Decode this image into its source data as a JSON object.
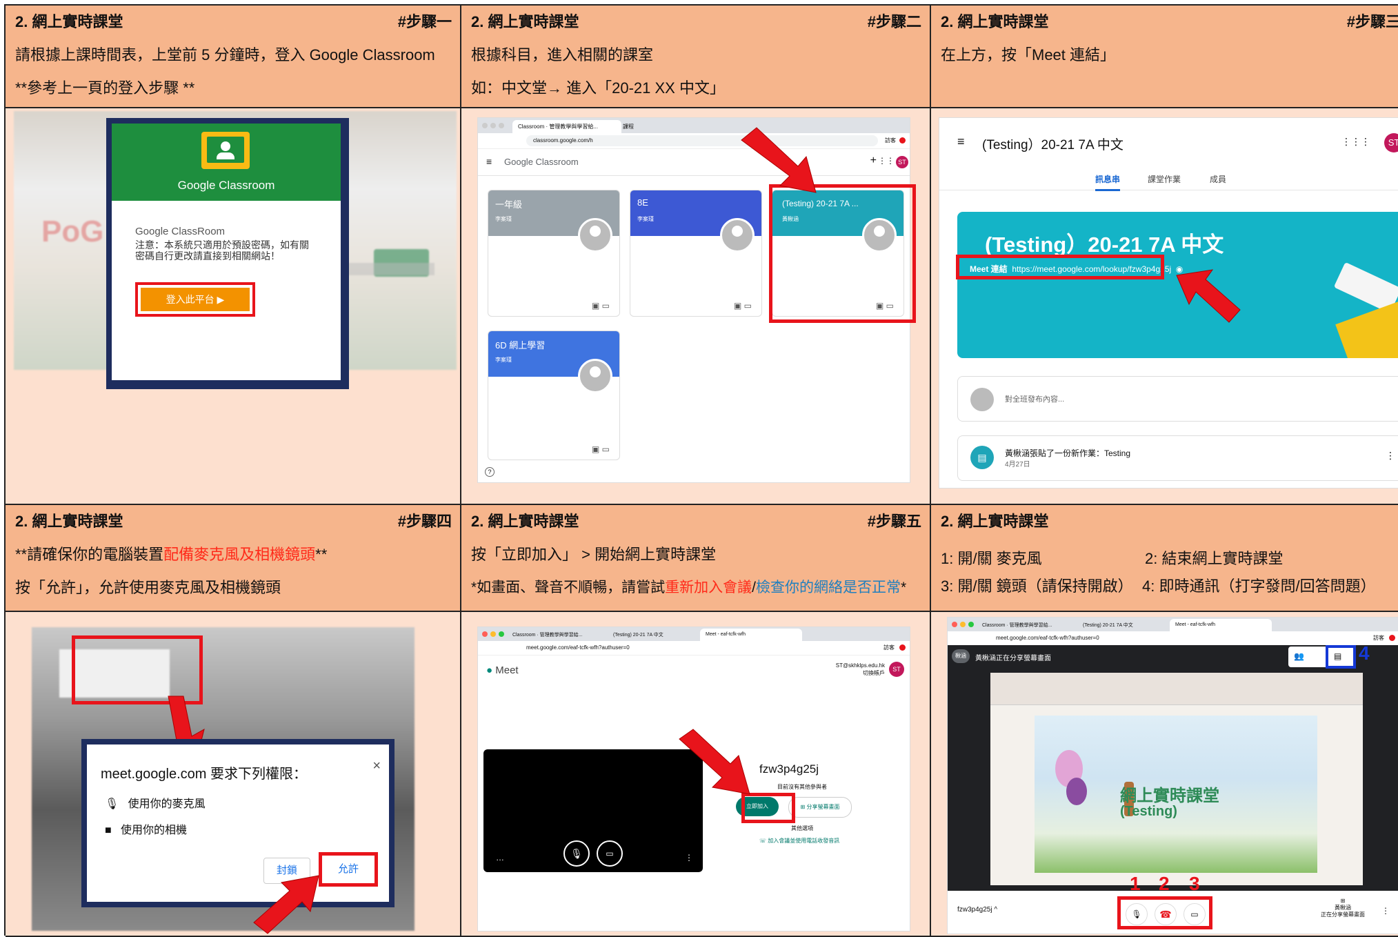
{
  "panels": [
    {
      "title": "2. 網上實時課堂",
      "step": "#步驟一",
      "line1": "請根據上課時間表，上堂前 5 分鐘時，登入 Google Classroom",
      "line2": "**參考上一頁的登入步驟 **",
      "shot": {
        "brand": "Google Classroom",
        "app_name": "Google ClassRoom",
        "notice": "注意：本系統只適用於預設密碼，如有關密碼自行更改請直接到相關網站！",
        "login_button": "登入此平台"
      }
    },
    {
      "title": "2. 網上實時課堂",
      "step": "#步驟二",
      "line1": "根據科目，進入相關的課室",
      "line2": "如：中文堂→ 進入「20-21 XX 中文」",
      "shot": {
        "tab1": "Classroom · 管理教學與學習給...",
        "tab2": "課程",
        "url": "classroom.google.com/h",
        "guest": "訪客",
        "header_brand": "Google Classroom",
        "avatar": "ST",
        "cards": [
          {
            "name": "一年級",
            "teacher": "李案瑾",
            "color": "#9aa4ab"
          },
          {
            "name": "8E",
            "teacher": "李案瑾",
            "color": "#3d59d4"
          },
          {
            "name": "(Testing) 20-21 7A ...",
            "teacher": "黃楸涵",
            "color": "#1fa5b8"
          },
          {
            "name": "6D 網上學習",
            "teacher": "李案瑾",
            "color": "#3f74e0"
          }
        ],
        "help": "?"
      }
    },
    {
      "title": "2. 網上實時課堂",
      "step": "#步驟三",
      "line1": "在上方，按「Meet 連結」",
      "line2": "",
      "shot": {
        "class_title": "(Testing）20-21 7A 中文",
        "tabs": [
          "訊息串",
          "課堂作業",
          "成員"
        ],
        "banner_title": "(Testing）20-21 7A 中文",
        "meet_label": "Meet 連結",
        "meet_link": "https://meet.google.com/lookup/fzw3p4g25j",
        "post_placeholder": "對全班發布內容...",
        "post_author": "黃楸涵張貼了一份新作業：Testing",
        "post_date": "4月27日",
        "avatar": "ST"
      }
    },
    {
      "title": "2. 網上實時課堂",
      "step": "#步驟四",
      "line1_a": "**請確保你的電腦裝置",
      "line1_b": "配備麥克風及相機鏡頭",
      "line1_c": "**",
      "line2": "按「允許」，允許使用麥克風及相機鏡頭",
      "shot": {
        "site": "meet.google.com 要求下列權限：",
        "perm_mic": "使用你的麥克風",
        "perm_cam": "使用你的相機",
        "block": "封鎖",
        "allow": "允許"
      }
    },
    {
      "title": "2. 網上實時課堂",
      "step": "#步驟五",
      "line1": "按「立即加入」 > 開始網上實時課堂",
      "line2_a": "*如畫面、聲音不順暢，請嘗試",
      "line2_b": "重新加入會議",
      "line2_c": "/",
      "line2_d": "檢查你的網絡是否正常",
      "line2_e": "*",
      "shot": {
        "tab1": "Classroom · 管理教學與學習給...",
        "tab2": "(Testing) 20-21 7A 中文",
        "tab3": "Meet - eaf-tcfk-wfh",
        "url": "meet.google.com/eaf-tcfk-wfh?authuser=0",
        "guest": "訪客",
        "meet_logo": "Meet",
        "account": "ST@skhklps.edu.hk",
        "switch_account": "切換帳戶",
        "avatar": "ST",
        "code": "fzw3p4g25j",
        "no_others": "目前沒有其他參與者",
        "join": "立即加入",
        "present": "分享螢幕畫面",
        "other_options": "其他選項",
        "phone": "加入會議並使用電話收發音訊"
      }
    },
    {
      "title": "2. 網上實時課堂",
      "step": "",
      "legend": [
        {
          "text": "1: 開/關 麥克風"
        },
        {
          "text": "2: 結束網上實時課堂"
        },
        {
          "text": "3: 開/關 鏡頭（請保持開啟）"
        },
        {
          "text": "4: 即時通訊（打字發問/回答問題）"
        }
      ],
      "shot": {
        "tab1": "Classroom · 管理教學與學習給...",
        "tab2": "(Testing) 20-21 7A 中文",
        "tab3": "Meet - eaf-tcfk-wfh",
        "url": "meet.google.com/eaf-tcfk-wfh?authuser=0",
        "guest": "訪客",
        "presenter_chip": "楸涵",
        "presenting": "黃楸涵正在分享螢幕畫面",
        "slide_title": "網上實時課堂",
        "slide_sub": "(Testing)",
        "code": "fzw3p4g25j",
        "presenter_name": "黃楸涵",
        "presenter_status": "正在分享螢幕畫面",
        "n1": "1",
        "n2": "2",
        "n3": "3",
        "n4": "4"
      }
    }
  ]
}
